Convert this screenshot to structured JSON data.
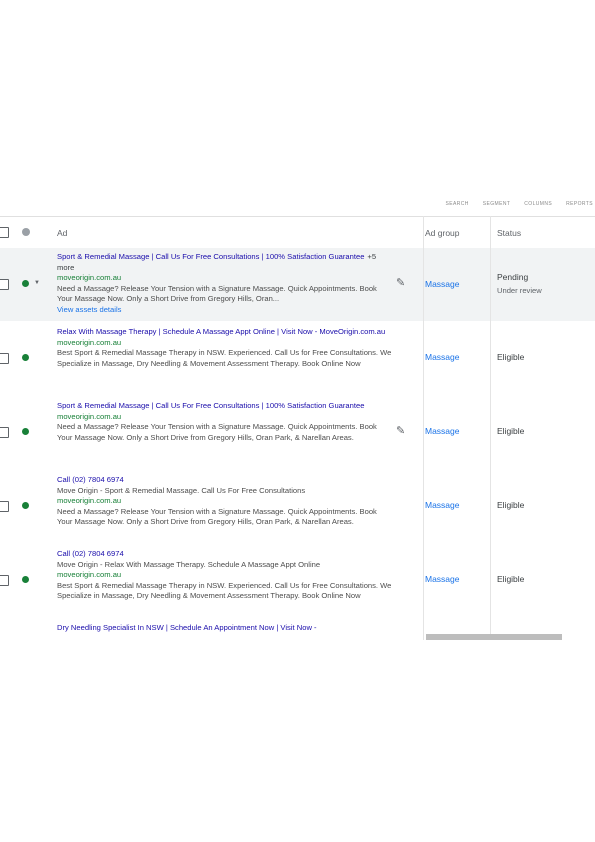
{
  "toolbar": {
    "search": "SEARCH",
    "segment": "SEGMENT",
    "columns": "COLUMNS",
    "reports": "REPORTS"
  },
  "columns": {
    "ad": "Ad",
    "ad_group": "Ad group",
    "status": "Status"
  },
  "rows": [
    {
      "headline": "Sport & Remedial Massage | Call Us For Free Consultations | 100% Satisfaction Guarantee",
      "more": "+5 more",
      "url": "moveorigin.com.au",
      "description": "Need a Massage? Release Your Tension with a Signature Massage. Quick Appointments. Book Your Massage Now. Only a Short Drive from Gregory Hills, Oran...",
      "assets_link": "View assets details",
      "ad_group": "Massage",
      "status": "Pending",
      "status_sub": "Under review"
    },
    {
      "headline": "Relax With Massage Therapy | Schedule A Massage Appt Online | Visit Now - MoveOrigin.com.au",
      "url": "moveorigin.com.au",
      "description": "Best Sport & Remedial Massage Therapy in NSW. Experienced. Call Us for Free Consultations. We Specialize in Massage, Dry Needling & Movement Assessment Therapy. Book Online Now",
      "ad_group": "Massage",
      "status": "Eligible"
    },
    {
      "headline": "Sport & Remedial Massage | Call Us For Free Consultations | 100% Satisfaction Guarantee",
      "url": "moveorigin.com.au",
      "description": "Need a Massage? Release Your Tension with a Signature Massage. Quick Appointments. Book Your Massage Now. Only a Short Drive from Gregory Hills, Oran Park, & Narellan Areas.",
      "ad_group": "Massage",
      "status": "Eligible"
    },
    {
      "headline": "Call (02) 7804 6974",
      "line2": "Move Origin - Sport & Remedial Massage. Call Us For Free Consultations",
      "url": "moveorigin.com.au",
      "description": "Need a Massage? Release Your Tension with a Signature Massage. Quick Appointments. Book Your Massage Now. Only a Short Drive from Gregory Hills, Oran Park, & Narellan Areas.",
      "ad_group": "Massage",
      "status": "Eligible"
    },
    {
      "headline": "Call (02) 7804 6974",
      "line2": "Move Origin - Relax With Massage Therapy. Schedule A Massage Appt Online",
      "url": "moveorigin.com.au",
      "description": "Best Sport & Remedial Massage Therapy in NSW. Experienced. Call Us for Free Consultations. We Specialize in Massage, Dry Needling & Movement Assessment Therapy. Book Online Now",
      "ad_group": "Massage",
      "status": "Eligible"
    },
    {
      "headline": "Dry Needling Specialist In NSW | Schedule An Appointment Now | Visit Now -"
    }
  ]
}
